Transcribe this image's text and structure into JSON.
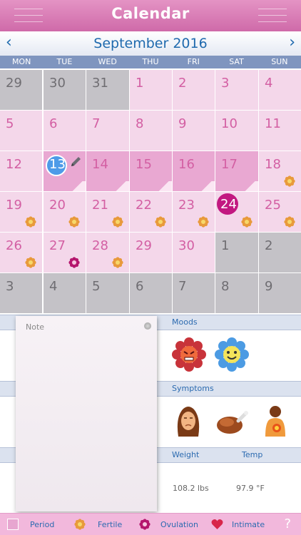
{
  "header": {
    "title": "Calendar"
  },
  "month_bar": {
    "label": "September 2016",
    "prev": "‹",
    "next": "›"
  },
  "weekdays": [
    "MON",
    "TUE",
    "WED",
    "THU",
    "FRI",
    "SAT",
    "SUN"
  ],
  "days": [
    {
      "n": "29",
      "t": "other"
    },
    {
      "n": "30",
      "t": "other"
    },
    {
      "n": "31",
      "t": "other"
    },
    {
      "n": "1",
      "t": "cur"
    },
    {
      "n": "2",
      "t": "cur"
    },
    {
      "n": "3",
      "t": "cur"
    },
    {
      "n": "4",
      "t": "cur"
    },
    {
      "n": "5",
      "t": "cur"
    },
    {
      "n": "6",
      "t": "cur"
    },
    {
      "n": "7",
      "t": "cur"
    },
    {
      "n": "8",
      "t": "cur"
    },
    {
      "n": "9",
      "t": "cur"
    },
    {
      "n": "10",
      "t": "cur"
    },
    {
      "n": "11",
      "t": "cur"
    },
    {
      "n": "12",
      "t": "cur"
    },
    {
      "n": "13",
      "t": "period",
      "today": true,
      "note": true
    },
    {
      "n": "14",
      "t": "period"
    },
    {
      "n": "15",
      "t": "period"
    },
    {
      "n": "16",
      "t": "period"
    },
    {
      "n": "17",
      "t": "period"
    },
    {
      "n": "18",
      "t": "cur",
      "mark": "fertile"
    },
    {
      "n": "19",
      "t": "cur",
      "mark": "fertile"
    },
    {
      "n": "20",
      "t": "cur",
      "mark": "fertile"
    },
    {
      "n": "21",
      "t": "cur",
      "mark": "fertile"
    },
    {
      "n": "22",
      "t": "cur",
      "mark": "fertile"
    },
    {
      "n": "23",
      "t": "cur",
      "mark": "fertile"
    },
    {
      "n": "24",
      "t": "cur",
      "selected": true,
      "mark": "fertile"
    },
    {
      "n": "25",
      "t": "cur",
      "mark": "fertile"
    },
    {
      "n": "26",
      "t": "cur",
      "mark": "fertile"
    },
    {
      "n": "27",
      "t": "cur",
      "mark": "ovulation"
    },
    {
      "n": "28",
      "t": "cur",
      "mark": "fertile"
    },
    {
      "n": "29",
      "t": "cur"
    },
    {
      "n": "30",
      "t": "cur"
    },
    {
      "n": "1",
      "t": "other"
    },
    {
      "n": "2",
      "t": "other"
    },
    {
      "n": "3",
      "t": "other"
    },
    {
      "n": "4",
      "t": "other"
    },
    {
      "n": "5",
      "t": "other"
    },
    {
      "n": "6",
      "t": "other"
    },
    {
      "n": "7",
      "t": "other"
    },
    {
      "n": "8",
      "t": "other"
    },
    {
      "n": "9",
      "t": "other"
    }
  ],
  "note": {
    "label": "Note"
  },
  "moods": {
    "header": "Moods",
    "icons": [
      "angry-flower-icon",
      "happy-flower-icon"
    ]
  },
  "symptoms": {
    "header": "Symptoms",
    "icons": [
      "headache-icon",
      "food-craving-icon",
      "back-pain-icon"
    ]
  },
  "measurements": {
    "weight_header": "Weight",
    "temp_header": "Temp",
    "weight_value": "108.2 lbs",
    "temp_value": "97.9 °F"
  },
  "legend": {
    "period": "Period",
    "fertile": "Fertile",
    "ovulation": "Ovulation",
    "intimate": "Intimate",
    "help": "?"
  },
  "colors": {
    "header": "#cf6aa9",
    "accent_blue": "#1f6aae",
    "period": "#e9a8d2",
    "day": "#f4d7ea",
    "other_month": "#c4c2c7",
    "today": "#4e9be8",
    "selected": "#c21880",
    "fertile": "#e89a3c",
    "ovulation": "#b5166e"
  }
}
